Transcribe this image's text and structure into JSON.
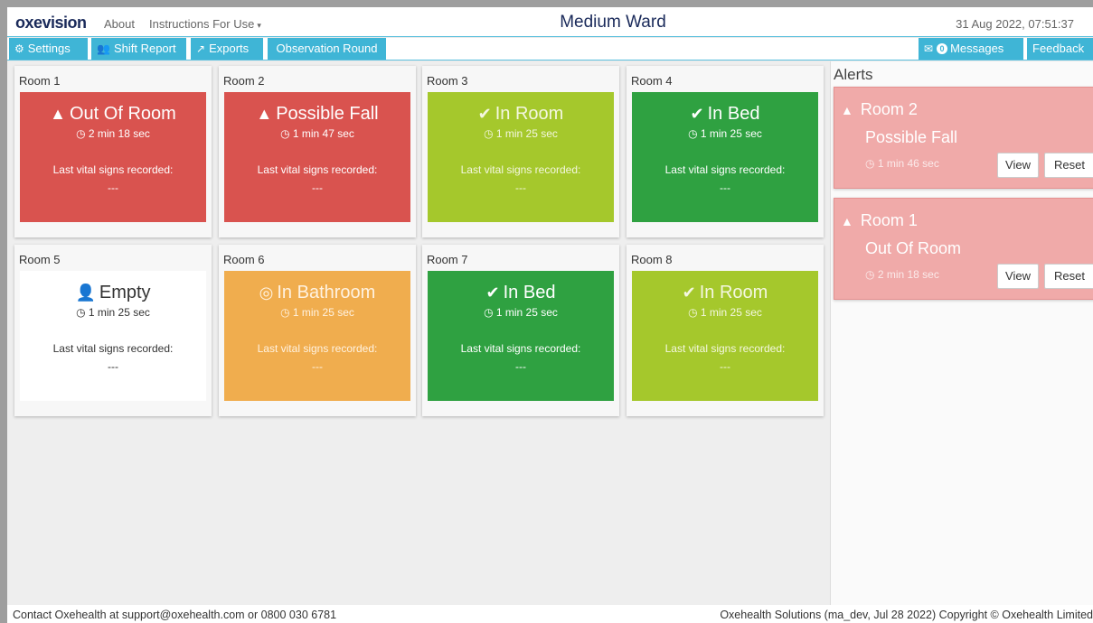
{
  "header": {
    "logo": "oxevision",
    "about": "About",
    "instructions": "Instructions For Use",
    "ward_title": "Medium Ward",
    "datetime": "31 Aug 2022, 07:51:37"
  },
  "toolbar": {
    "settings": "Settings",
    "shift_report": "Shift Report",
    "exports": "Exports",
    "observation_round": "Observation Round",
    "messages": "Messages",
    "messages_count": "0",
    "feedback": "Feedback"
  },
  "rooms": [
    {
      "title": "Room 1",
      "status": "Out Of Room",
      "icon": "warning-icon",
      "duration": "2 min 18 sec",
      "vitals_label": "Last vital signs recorded:",
      "vitals_value": "---",
      "color": "#d9534f"
    },
    {
      "title": "Room 2",
      "status": "Possible Fall",
      "icon": "warning-icon",
      "duration": "1 min 47 sec",
      "vitals_label": "Last vital signs recorded:",
      "vitals_value": "---",
      "color": "#d9534f"
    },
    {
      "title": "Room 3",
      "status": "In Room",
      "icon": "check-circle-icon",
      "duration": "1 min 25 sec",
      "vitals_label": "Last vital signs recorded:",
      "vitals_value": "---",
      "color": "#a5c82c"
    },
    {
      "title": "Room 4",
      "status": "In Bed",
      "icon": "check-circle-icon",
      "duration": "1 min 25 sec",
      "vitals_label": "Last vital signs recorded:",
      "vitals_value": "---",
      "color": "#2fa141"
    },
    {
      "title": "Room 5",
      "status": "Empty",
      "icon": "user-times-icon",
      "duration": "1 min 25 sec",
      "vitals_label": "Last vital signs recorded:",
      "vitals_value": "---",
      "color": "#ffffff"
    },
    {
      "title": "Room 6",
      "status": "In Bathroom",
      "icon": "eye-slash-icon",
      "duration": "1 min 25 sec",
      "vitals_label": "Last vital signs recorded:",
      "vitals_value": "---",
      "color": "#f0ad4e"
    },
    {
      "title": "Room 7",
      "status": "In Bed",
      "icon": "check-circle-icon",
      "duration": "1 min 25 sec",
      "vitals_label": "Last vital signs recorded:",
      "vitals_value": "---",
      "color": "#2fa141"
    },
    {
      "title": "Room 8",
      "status": "In Room",
      "icon": "check-circle-icon",
      "duration": "1 min 25 sec",
      "vitals_label": "Last vital signs recorded:",
      "vitals_value": "---",
      "color": "#a5c82c"
    }
  ],
  "alerts": {
    "title": "Alerts",
    "items": [
      {
        "room": "Room 2",
        "status": "Possible Fall",
        "duration": "1 min 46 sec",
        "view": "View",
        "reset": "Reset"
      },
      {
        "room": "Room 1",
        "status": "Out Of Room",
        "duration": "2 min 18 sec",
        "view": "View",
        "reset": "Reset"
      }
    ]
  },
  "footer": {
    "contact": "Contact Oxehealth at support@oxehealth.com or 0800 030 6781",
    "copyright": "Oxehealth Solutions (ma_dev, Jul 28 2022) Copyright © Oxehealth Limited"
  }
}
